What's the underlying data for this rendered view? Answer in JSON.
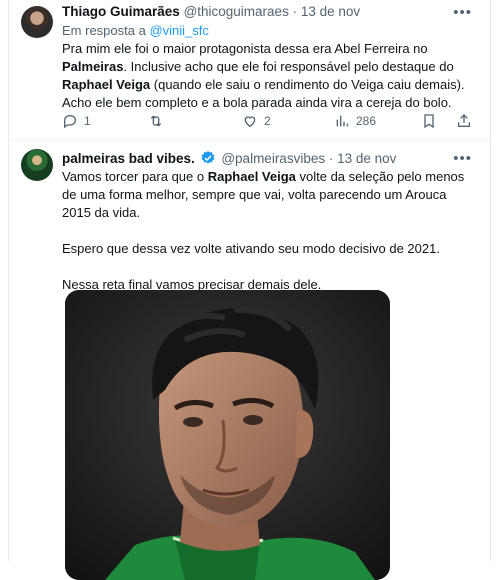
{
  "tweets": [
    {
      "author_name": "Thiago Guimarães",
      "author_handle": "@thicoguimaraes",
      "separator": "·",
      "timestamp": "13 de nov",
      "replying_prefix": "Em resposta a ",
      "replying_to": "@vinii_sfc",
      "text_parts": [
        "Pra mim ele foi o maior protagonista dessa era Abel Ferreira no ",
        "Palmeiras",
        ". Inclusive acho que ele foi responsável pelo destaque do ",
        "Raphael Veiga",
        " (quando ele saiu o rendimento do Veiga caiu demais). Acho ele bem completo e a bola parada ainda vira a cereja do bolo."
      ],
      "actions": {
        "reply_count": "1",
        "retweet_count": "",
        "like_count": "2",
        "views_count": "286"
      },
      "more_icon": "more-icon"
    },
    {
      "author_name": "palmeiras bad vibes.",
      "author_handle": "@palmeirasvibes",
      "separator": "·",
      "timestamp": "13 de nov",
      "verified": true,
      "verified_color": "#1d9bf0",
      "paragraph1_parts": [
        "Vamos torcer para que o ",
        "Raphael Veiga",
        " volte da seleção pelo menos de uma forma melhor, sempre que vai, volta parecendo um Arouca 2015 da vida."
      ],
      "paragraph2": "Espero que dessa vez volte ativando seu modo decisivo de 2021.",
      "paragraph3": "Nessa reta final vamos precisar demais dele.",
      "more_icon": "more-icon"
    }
  ],
  "colors": {
    "link": "#1d9bf0",
    "secondary_text": "#536471",
    "primary_text": "#0f1419",
    "jersey_green": "#1f8a3b"
  }
}
